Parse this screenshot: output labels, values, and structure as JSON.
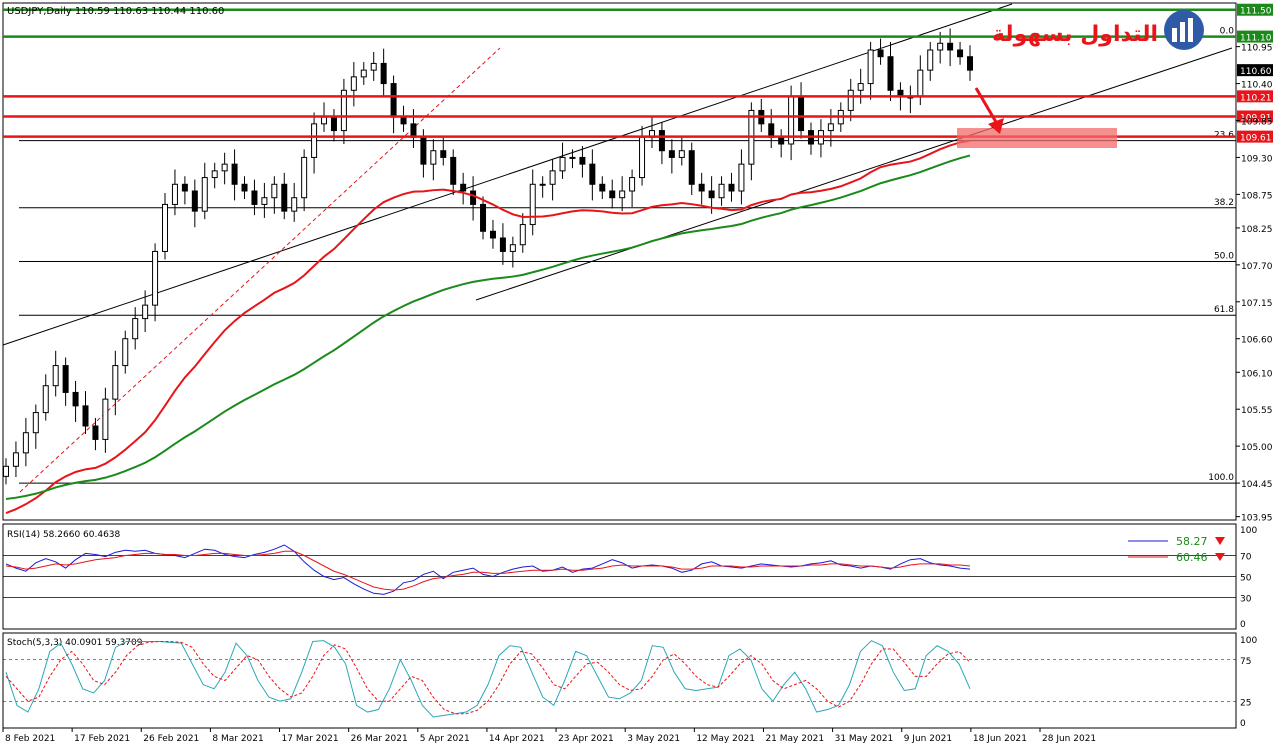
{
  "chart_data": {
    "type": "candlestick",
    "symbol_header": "USDJPY,Daily  110.59 110.63 110.44 110.60",
    "logo_text": "التداول بسهولة",
    "price_axis_ticks": [
      "110.95",
      "110.40",
      "109.85",
      "109.30",
      "108.75",
      "108.25",
      "107.70",
      "107.15",
      "106.60",
      "106.10",
      "105.55",
      "105.00",
      "104.45",
      "103.95"
    ],
    "price_ylim": [
      103.9,
      111.6
    ],
    "horizontal_levels": [
      {
        "label": "111.50",
        "price": 111.5,
        "color": "#1b8a1b"
      },
      {
        "label": "111.10",
        "price": 111.1,
        "color": "#1b8a1b"
      },
      {
        "label": "110.21",
        "price": 110.21,
        "color": "#e8141a"
      },
      {
        "label": "109.91",
        "price": 109.91,
        "color": "#e8141a"
      },
      {
        "label": "109.61",
        "price": 109.61,
        "color": "#e8141a"
      }
    ],
    "current_price": {
      "label": "110.60",
      "price": 110.6
    },
    "fib_levels": [
      {
        "label": "0.0",
        "price": 111.1
      },
      {
        "label": "23.6",
        "price": 109.55
      },
      {
        "label": "38.2",
        "price": 108.55
      },
      {
        "label": "50.0",
        "price": 107.75
      },
      {
        "label": "61.8",
        "price": 106.95
      },
      {
        "label": "100.0",
        "price": 104.45
      }
    ],
    "x_ticks": [
      "8 Feb 2021",
      "17 Feb 2021",
      "26 Feb 2021",
      "8 Mar 2021",
      "17 Mar 2021",
      "26 Mar 2021",
      "5 Apr 2021",
      "14 Apr 2021",
      "23 Apr 2021",
      "3 May 2021",
      "12 May 2021",
      "21 May 2021",
      "31 May 2021",
      "9 Jun 2021",
      "18 Jun 2021",
      "28 Jun 2021"
    ],
    "closes": [
      104.7,
      104.9,
      105.2,
      105.5,
      105.9,
      106.2,
      105.8,
      105.6,
      105.3,
      105.1,
      105.7,
      106.2,
      106.6,
      106.9,
      107.1,
      107.9,
      108.6,
      108.9,
      108.8,
      108.5,
      109.0,
      109.1,
      109.2,
      108.9,
      108.8,
      108.6,
      108.7,
      108.9,
      108.5,
      108.7,
      109.3,
      109.8,
      109.9,
      109.7,
      110.3,
      110.5,
      110.6,
      110.7,
      110.4,
      109.9,
      109.8,
      109.6,
      109.2,
      109.4,
      109.3,
      108.9,
      108.8,
      108.6,
      108.2,
      108.1,
      107.9,
      108.0,
      108.3,
      108.9,
      108.9,
      109.1,
      109.3,
      109.3,
      109.2,
      108.9,
      108.8,
      108.7,
      108.8,
      109.0,
      109.6,
      109.7,
      109.4,
      109.3,
      109.4,
      108.9,
      108.8,
      108.7,
      108.9,
      108.8,
      109.2,
      110.0,
      109.8,
      109.6,
      109.5,
      110.2,
      109.7,
      109.5,
      109.7,
      109.8,
      110.0,
      110.3,
      110.4,
      110.9,
      110.8,
      110.3,
      110.2,
      110.2,
      110.6,
      110.9,
      111.0,
      110.9,
      110.8,
      110.6
    ],
    "ma_red_start": 103.95,
    "ma_red_end": 109.55,
    "ma_green_start": 104.2,
    "ma_green_end": 109.33,
    "rsi": {
      "label": "RSI(14) 58.2660 60.4638",
      "levels": [
        "100",
        "70",
        "50",
        "30",
        "0"
      ],
      "value_blue": "58.27",
      "value_red": "60.46",
      "blue": [
        62,
        58,
        55,
        63,
        67,
        64,
        58,
        66,
        72,
        71,
        69,
        73,
        75,
        74,
        75,
        72,
        71,
        70,
        68,
        72,
        76,
        75,
        71,
        69,
        68,
        71,
        73,
        76,
        80,
        74,
        64,
        56,
        50,
        47,
        49,
        43,
        38,
        34,
        33,
        36,
        44,
        46,
        52,
        55,
        48,
        54,
        56,
        58,
        52,
        50,
        54,
        57,
        59,
        60,
        55,
        56,
        59,
        54,
        57,
        58,
        62,
        66,
        63,
        58,
        60,
        61,
        60,
        58,
        54,
        56,
        62,
        64,
        60,
        59,
        58,
        60,
        62,
        61,
        60,
        59,
        60,
        62,
        63,
        65,
        61,
        60,
        58,
        60,
        59,
        57,
        62,
        66,
        67,
        63,
        61,
        60,
        58,
        57
      ],
      "red": [
        60,
        59,
        57,
        58,
        60,
        62,
        61,
        62,
        64,
        66,
        67,
        68,
        70,
        71,
        72,
        72,
        71,
        71,
        70,
        70,
        71,
        72,
        72,
        71,
        70,
        70,
        71,
        72,
        74,
        74,
        70,
        65,
        60,
        55,
        52,
        48,
        44,
        40,
        38,
        37,
        38,
        41,
        45,
        48,
        49,
        51,
        52,
        54,
        54,
        53,
        53,
        54,
        55,
        56,
        56,
        56,
        57,
        56,
        56,
        57,
        58,
        60,
        61,
        60,
        60,
        60,
        60,
        59,
        57,
        57,
        58,
        60,
        60,
        60,
        59,
        59,
        60,
        60,
        60,
        60,
        60,
        61,
        61,
        62,
        62,
        61,
        60,
        60,
        59,
        58,
        59,
        61,
        62,
        62,
        62,
        61,
        61,
        60
      ]
    },
    "stoch": {
      "label": "Stoch(5,3,3) 40.0901 59.3709",
      "levels": [
        "100",
        "75",
        "25",
        "0"
      ],
      "main": [
        60,
        20,
        12,
        40,
        85,
        95,
        70,
        40,
        35,
        50,
        90,
        97,
        97,
        97,
        97,
        96,
        95,
        70,
        45,
        40,
        60,
        95,
        80,
        50,
        30,
        25,
        28,
        60,
        97,
        98,
        90,
        70,
        20,
        12,
        15,
        40,
        75,
        50,
        20,
        6,
        8,
        10,
        12,
        20,
        45,
        80,
        92,
        90,
        60,
        30,
        20,
        50,
        85,
        80,
        55,
        30,
        28,
        35,
        50,
        92,
        90,
        60,
        40,
        38,
        40,
        42,
        80,
        88,
        75,
        40,
        25,
        45,
        60,
        40,
        12,
        15,
        20,
        45,
        85,
        98,
        92,
        60,
        38,
        40,
        80,
        92,
        85,
        70,
        40
      ],
      "signal": [
        55,
        40,
        25,
        30,
        55,
        75,
        85,
        70,
        50,
        45,
        60,
        80,
        92,
        96,
        97,
        97,
        96,
        90,
        70,
        55,
        50,
        65,
        80,
        75,
        55,
        40,
        30,
        35,
        55,
        80,
        93,
        88,
        65,
        40,
        25,
        25,
        40,
        55,
        50,
        30,
        15,
        10,
        10,
        14,
        25,
        45,
        70,
        85,
        82,
        65,
        45,
        40,
        55,
        70,
        72,
        60,
        45,
        38,
        40,
        55,
        75,
        82,
        70,
        55,
        45,
        42,
        55,
        70,
        80,
        70,
        50,
        40,
        45,
        50,
        40,
        25,
        18,
        25,
        45,
        70,
        88,
        88,
        72,
        55,
        55,
        70,
        82,
        85,
        72
      ]
    }
  }
}
